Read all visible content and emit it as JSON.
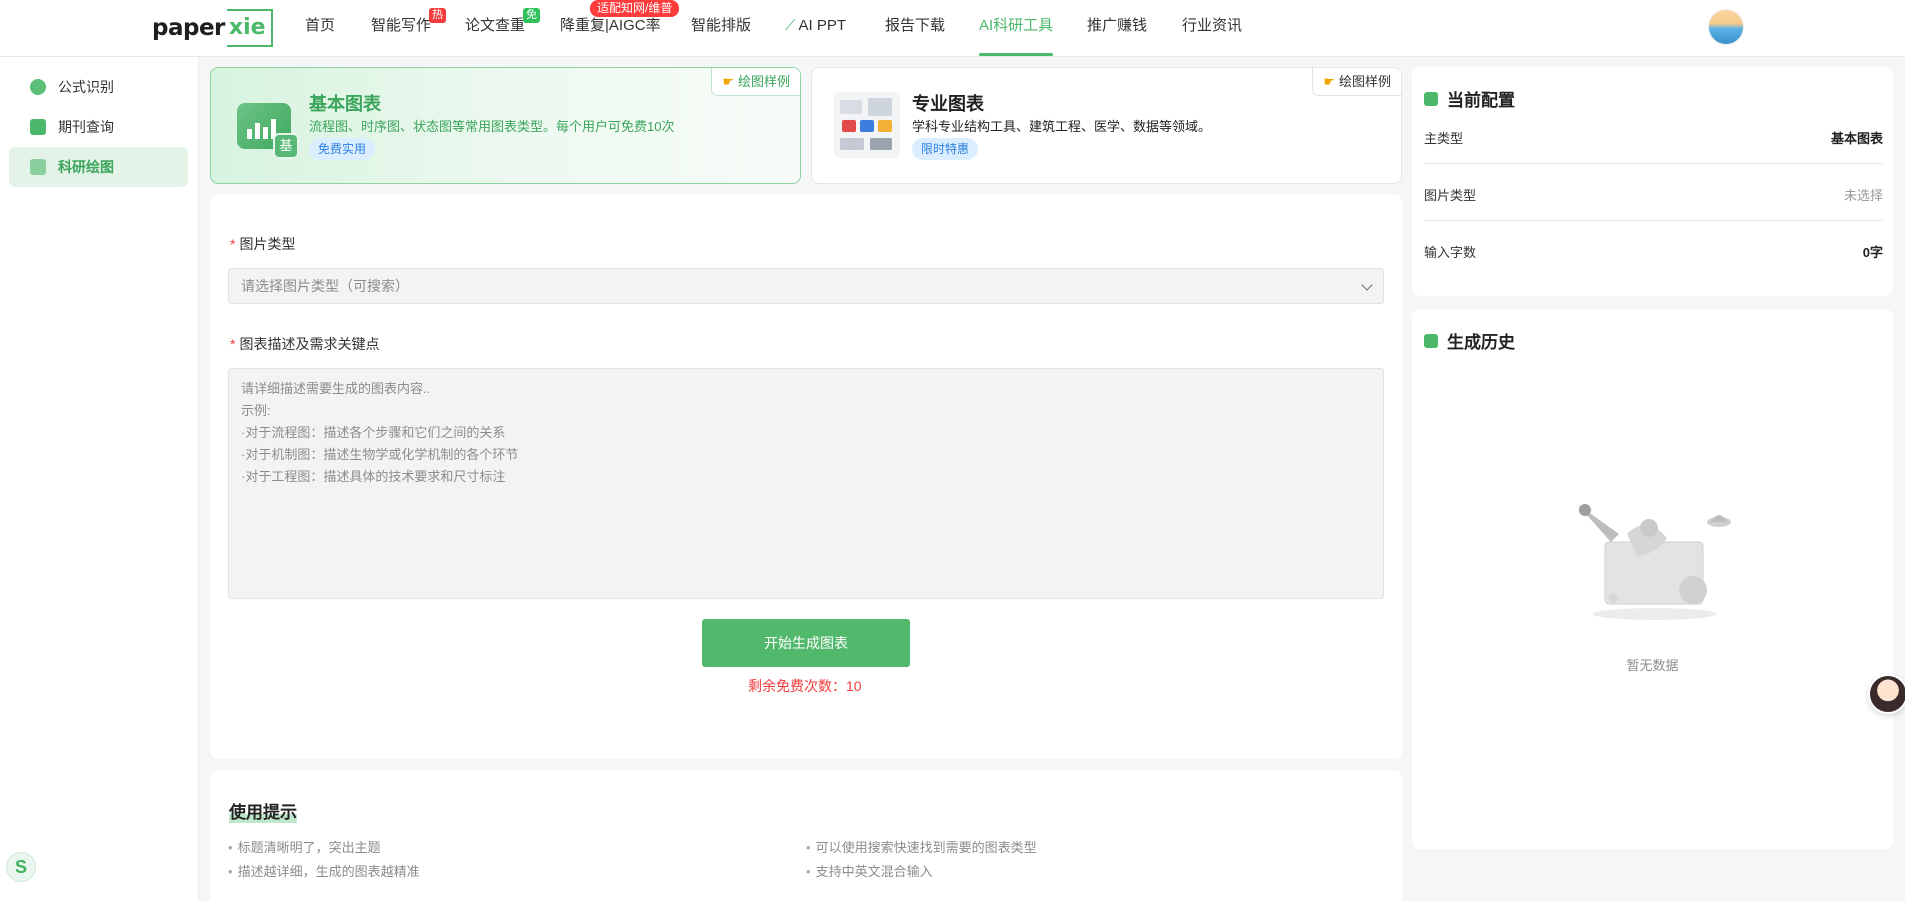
{
  "header": {
    "logo_main": "paper",
    "logo_accent": "xie",
    "nav": [
      {
        "label": "首页"
      },
      {
        "label": "智能写作",
        "badge": "热"
      },
      {
        "label": "论文查重",
        "badge": "免"
      },
      {
        "label": "降重复|AIGC率",
        "badge": "适配知网/维普"
      },
      {
        "label": "智能排版"
      },
      {
        "label": "AI PPT"
      },
      {
        "label": "报告下载"
      },
      {
        "label": "AI科研工具",
        "active": true
      },
      {
        "label": "推广赚钱"
      },
      {
        "label": "行业资讯"
      }
    ]
  },
  "sidebar": {
    "items": [
      {
        "label": "公式识别"
      },
      {
        "label": "期刊查询"
      },
      {
        "label": "科研绘图",
        "active": true
      }
    ]
  },
  "cards": {
    "basic": {
      "title": "基本图表",
      "desc": "流程图、时序图、状态图等常用图表类型。每个用户可免费10次",
      "tag": "免费实用",
      "sample": "绘图样例",
      "icon_char": "基"
    },
    "pro": {
      "title": "专业图表",
      "desc": "学科专业结构工具、建筑工程、医学、数据等领域。",
      "tag": "限时特惠",
      "sample": "绘图样例"
    }
  },
  "form": {
    "image_type_label": "图片类型",
    "image_type_placeholder": "请选择图片类型（可搜索）",
    "desc_label": "图表描述及需求关键点",
    "desc_placeholder_lines": [
      "请详细描述需要生成的图表内容..",
      "",
      "示例:",
      "·对于流程图：描述各个步骤和它们之间的关系",
      "·对于机制图：描述生物学或化学机制的各个环节",
      "·对于工程图：描述具体的技术要求和尺寸标注"
    ],
    "generate_button": "开始生成图表",
    "remaining_text": "剩余免费次数：10"
  },
  "tips": {
    "title": "使用提示",
    "items": [
      "标题清晰明了，突出主题",
      "描述越详细，生成的图表越精准",
      "可以使用搜索快速找到需要的图表类型",
      "支持中英文混合输入"
    ]
  },
  "config": {
    "title": "当前配置",
    "rows": [
      {
        "key": "主类型",
        "value": "基本图表"
      },
      {
        "key": "图片类型",
        "value": "未选择"
      },
      {
        "key": "输入字数",
        "value": "0字"
      }
    ]
  },
  "history": {
    "title": "生成历史",
    "empty_text": "暂无数据"
  },
  "colors": {
    "brand_green": "#4cb86a",
    "danger_red": "#f23c3c",
    "tag_blue": "#2d7fe0"
  }
}
